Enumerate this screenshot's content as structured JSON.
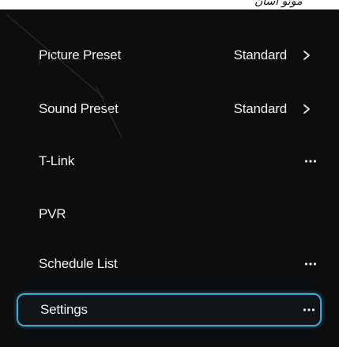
{
  "header": {
    "scribble_text": "موتو آسان"
  },
  "menu": {
    "items": [
      {
        "label": "Picture Preset",
        "value": "Standard",
        "action": "chevron"
      },
      {
        "label": "Sound Preset",
        "value": "Standard",
        "action": "chevron"
      },
      {
        "label": "T-Link",
        "value": "",
        "action": "more"
      },
      {
        "label": "PVR",
        "value": "",
        "action": "none"
      },
      {
        "label": "Schedule List",
        "value": "",
        "action": "more"
      },
      {
        "label": "Settings",
        "value": "",
        "action": "more",
        "focused": true
      }
    ]
  },
  "colors": {
    "background": "#0b0d0e",
    "text": "#f2f2f2",
    "focus_border": "#3fa7d8"
  }
}
